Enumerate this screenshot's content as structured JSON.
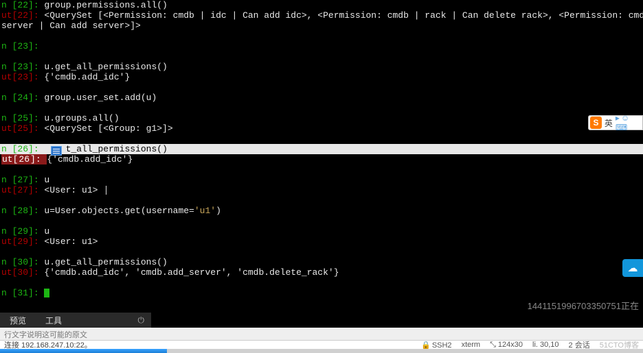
{
  "lines": [
    {
      "kind": "in",
      "n": "22",
      "text": "group.permissions.all()"
    },
    {
      "kind": "out",
      "n": "22",
      "text": "<QuerySet [<Permission: cmdb | idc | Can add idc>, <Permission: cmdb | rack | Can delete rack>, <Permission: cmdb |"
    },
    {
      "kind": "wrap",
      "text": "server | Can add server>]>"
    },
    {
      "kind": "blank"
    },
    {
      "kind": "in",
      "n": "23",
      "text": ""
    },
    {
      "kind": "blank"
    },
    {
      "kind": "in",
      "n": "23",
      "text": "u.get_all_permissions()"
    },
    {
      "kind": "out",
      "n": "23",
      "text": "{'cmdb.add_idc'}"
    },
    {
      "kind": "blank"
    },
    {
      "kind": "in",
      "n": "24",
      "text": "group.user_set.add(u)"
    },
    {
      "kind": "blank"
    },
    {
      "kind": "in",
      "n": "25",
      "text": "u.groups.all()"
    },
    {
      "kind": "out",
      "n": "25",
      "text": "<QuerySet [<Group: g1>]>"
    },
    {
      "kind": "blank"
    },
    {
      "kind": "in-sel",
      "n": "26",
      "pre": "u.ge",
      "sel": "t_all_permissions()"
    },
    {
      "kind": "out-hl",
      "n": "26",
      "text": "{'cmdb.add_idc'}"
    },
    {
      "kind": "blank"
    },
    {
      "kind": "in",
      "n": "27",
      "text": "u"
    },
    {
      "kind": "out-caret",
      "n": "27",
      "text": "<User: u1>"
    },
    {
      "kind": "blank"
    },
    {
      "kind": "in-str",
      "n": "28",
      "pre": "u=User.objects.get(username=",
      "str": "'u1'",
      "post": ")"
    },
    {
      "kind": "blank"
    },
    {
      "kind": "in",
      "n": "29",
      "text": "u"
    },
    {
      "kind": "out",
      "n": "29",
      "text": "<User: u1>"
    },
    {
      "kind": "blank"
    },
    {
      "kind": "in",
      "n": "30",
      "text": "u.get_all_permissions()"
    },
    {
      "kind": "out",
      "n": "30",
      "text": "{'cmdb.add_idc', 'cmdb.add_server', 'cmdb.delete_rack'}"
    },
    {
      "kind": "blank"
    },
    {
      "kind": "in-cursor",
      "n": "31"
    }
  ],
  "prompts": {
    "in": "n [",
    "out": "ut[",
    "close": "]: "
  },
  "watermark": "1441151996703350751正在",
  "toolbar": {
    "tab1": "预览",
    "tab2": "工具",
    "power": "⏻"
  },
  "bottom_strip": {
    "truncated": "行文字说明这可能的原文",
    "conn": "连接 192.168.247.10:22。"
  },
  "status": {
    "ssh": "SSH2",
    "term": "xterm",
    "size": "124x30",
    "pos": "30,10",
    "sessions": "2 会话",
    "brand": "51CTO博客"
  },
  "progress_pct": 26,
  "ime": {
    "letter": "S",
    "lang": "英",
    "icons": "▸☺⌨"
  },
  "cloud_icon": "☁"
}
